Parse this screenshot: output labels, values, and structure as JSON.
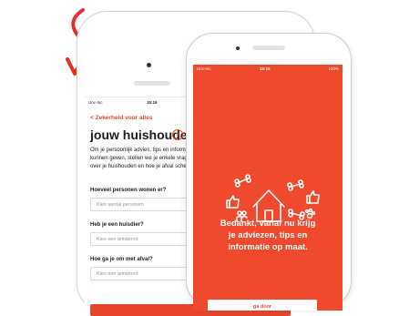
{
  "left_phone": {
    "status": {
      "carrier": "Unc-Inc",
      "time": "15:16"
    },
    "back_link": "Zekerheid voor alles",
    "title": "jouw huishouden",
    "intro_lines": [
      "Om je persoonlijk advies, tips en inform",
      "kunnen geven, stellen we je enkele vrag",
      "over je huishouden en hoe je afval sche"
    ],
    "questions": [
      {
        "label": "Hoeveel personen wonen er?",
        "placeholder": "Kies aantal personen"
      },
      {
        "label": "Heb je een huisdier?",
        "placeholder": "Kies een antwoord"
      },
      {
        "label": "Hoe ga je om met afval?",
        "placeholder": "Kies een antwoord"
      }
    ]
  },
  "right_phone": {
    "status": {
      "carrier": "Unc-Inc",
      "time": "15:16",
      "battery": "100%"
    },
    "thanks_lines": [
      "Bedankt, vanaf nu krijg",
      "je adviezen, tips en",
      "informatie op maat."
    ],
    "button_label": "ga door"
  },
  "colors": {
    "accent": "#ef4a2e",
    "arrow": "#e5312b"
  },
  "icons": [
    "arrow-icon",
    "info-icon",
    "house-icon",
    "bone-icon",
    "thumbs-up-icon",
    "family-icon",
    "paw-icon"
  ]
}
